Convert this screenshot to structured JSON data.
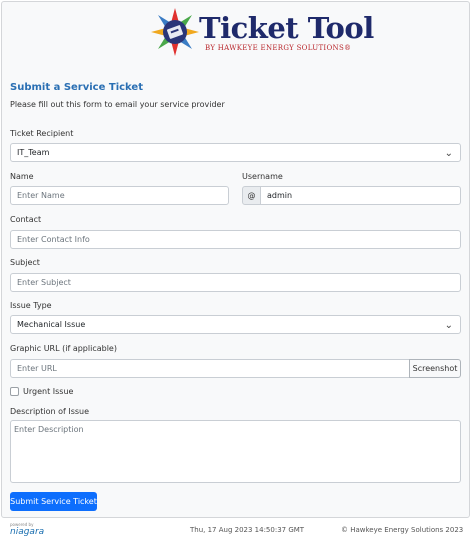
{
  "logo": {
    "title": "Ticket Tool",
    "subtitle": "BY HAWKEYE ENERGY SOLUTIONS®"
  },
  "form": {
    "heading": "Submit a Service Ticket",
    "subheading": "Please fill out this form to email your service provider",
    "recipient": {
      "label": "Ticket Recipient",
      "value": "IT_Team"
    },
    "name": {
      "label": "Name",
      "placeholder": "Enter Name"
    },
    "username": {
      "label": "Username",
      "prefix": "@",
      "value": "admin"
    },
    "contact": {
      "label": "Contact",
      "placeholder": "Enter Contact Info"
    },
    "subject": {
      "label": "Subject",
      "placeholder": "Enter Subject"
    },
    "issue_type": {
      "label": "Issue Type",
      "value": "Mechanical Issue"
    },
    "graphic_url": {
      "label": "Graphic URL (if applicable)",
      "placeholder": "Enter URL",
      "button": "Screenshot"
    },
    "urgent": {
      "label": "Urgent Issue",
      "checked": false
    },
    "description": {
      "label": "Description of Issue",
      "placeholder": "Enter Description"
    },
    "submit": "Submit Service Ticket"
  },
  "footer": {
    "brand_small": "powered by",
    "brand": "niagara",
    "timestamp": "Thu, 17 Aug 2023 14:50:37 GMT",
    "copyright": "© Hawkeye Energy Solutions 2023"
  },
  "colors": {
    "accent": "#0d6efd",
    "heading": "#2a6fb3",
    "logo_navy": "#1f2a6b",
    "logo_red": "#b8262b"
  },
  "icons": {
    "dropdown": "chevron-down-icon",
    "logo": "sunburst-ticket-icon"
  }
}
